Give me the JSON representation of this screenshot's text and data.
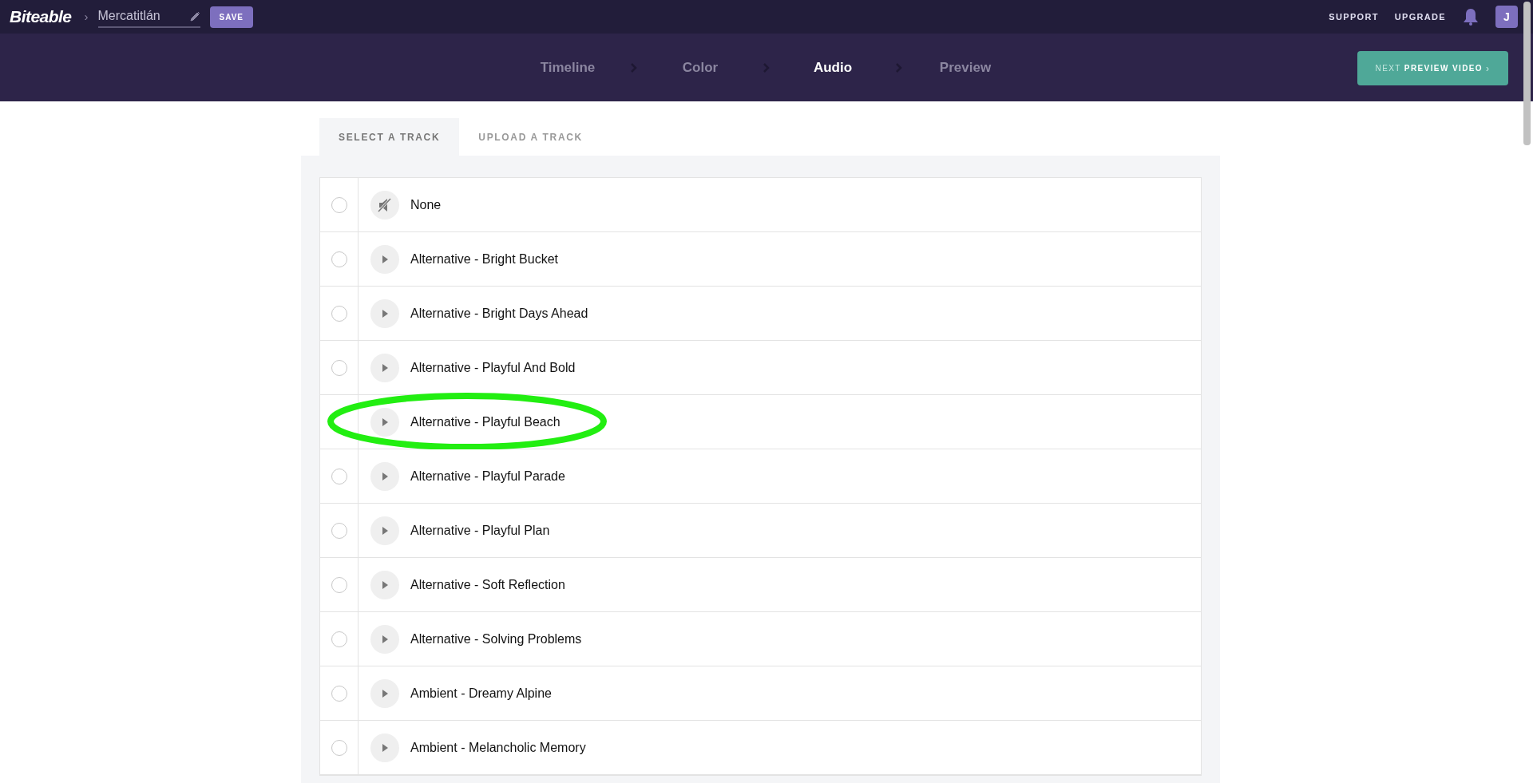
{
  "topbar": {
    "logo": "Biteable",
    "separator": "›",
    "project_name": "Mercatitlán",
    "save": "SAVE",
    "links": [
      "SUPPORT",
      "UPGRADE"
    ],
    "avatar": "J"
  },
  "steps": [
    {
      "label": "Timeline",
      "selected": false
    },
    {
      "label": "Color",
      "selected": false
    },
    {
      "label": "Audio",
      "selected": true
    },
    {
      "label": "Preview",
      "selected": false
    }
  ],
  "next_button": {
    "prefix": "NEXT",
    "label": "PREVIEW VIDEO",
    "arrow": "›"
  },
  "tabs": [
    {
      "label": "SELECT A TRACK",
      "selected": true
    },
    {
      "label": "UPLOAD A TRACK",
      "selected": false
    }
  ],
  "tracks": [
    {
      "name": "None",
      "kind": "mute",
      "selected": false,
      "highlighted": false
    },
    {
      "name": "Alternative - Bright Bucket",
      "kind": "play",
      "selected": false,
      "highlighted": false
    },
    {
      "name": "Alternative - Bright Days Ahead",
      "kind": "play",
      "selected": false,
      "highlighted": false
    },
    {
      "name": "Alternative - Playful And Bold",
      "kind": "play",
      "selected": false,
      "highlighted": false
    },
    {
      "name": "Alternative - Playful Beach",
      "kind": "play",
      "selected": false,
      "highlighted": true
    },
    {
      "name": "Alternative - Playful Parade",
      "kind": "play",
      "selected": false,
      "highlighted": false
    },
    {
      "name": "Alternative - Playful Plan",
      "kind": "play",
      "selected": false,
      "highlighted": false
    },
    {
      "name": "Alternative - Soft Reflection",
      "kind": "play",
      "selected": false,
      "highlighted": false
    },
    {
      "name": "Alternative - Solving Problems",
      "kind": "play",
      "selected": false,
      "highlighted": false
    },
    {
      "name": "Ambient - Dreamy Alpine",
      "kind": "play",
      "selected": false,
      "highlighted": false
    },
    {
      "name": "Ambient - Melancholic Memory",
      "kind": "play",
      "selected": false,
      "highlighted": false
    }
  ]
}
